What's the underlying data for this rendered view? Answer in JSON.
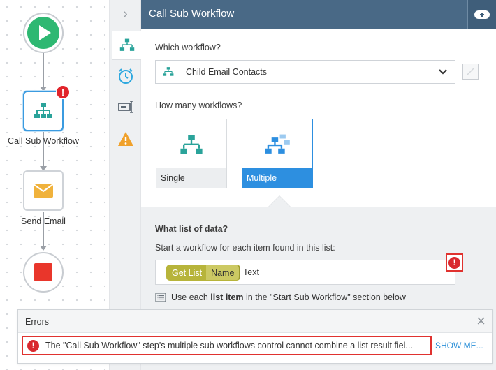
{
  "canvas": {
    "nodes": [
      {
        "label": ""
      },
      {
        "label": "Call Sub Workflow"
      },
      {
        "label": "Send Email"
      },
      {
        "label": ""
      }
    ],
    "error_badge": "!"
  },
  "panel": {
    "title": "Call Sub Workflow",
    "collapse_glyph": "›",
    "which_workflow_label": "Which workflow?",
    "selected_workflow": "Child Email Contacts",
    "how_many_label": "How many workflows?",
    "options": [
      {
        "label": "Single",
        "selected": false
      },
      {
        "label": "Multiple",
        "selected": true
      }
    ],
    "list_section": {
      "title": "What list of data?",
      "description": "Start a workflow for each item found in this list:",
      "chip_primary": "Get List",
      "chip_secondary": "Name",
      "trailing_text": "Text",
      "hint_prefix": "Use each ",
      "hint_bold": "list item",
      "hint_suffix": " in the \"Start Sub Workflow\" section below"
    }
  },
  "errors": {
    "title": "Errors",
    "close_glyph": "×",
    "items": [
      {
        "text": "The \"Call Sub Workflow\" step's multiple sub workflows control cannot combine a list result fiel..."
      }
    ],
    "show_more": "SHOW ME..."
  },
  "colors": {
    "header_bg": "#496986",
    "accent_blue": "#2d8fe0",
    "error_red": "#e0322f",
    "start_green": "#2eb872",
    "stop_red": "#e9362b",
    "teal_icon": "#2aa39a",
    "email_orange": "#f0b23c"
  },
  "icons": [
    "play-icon",
    "sub-workflow-icon",
    "email-icon",
    "stop-icon",
    "chevron-right-icon",
    "timer-icon",
    "text-field-icon",
    "warning-icon",
    "add-icon",
    "chevron-down-icon",
    "error-icon",
    "close-icon"
  ]
}
